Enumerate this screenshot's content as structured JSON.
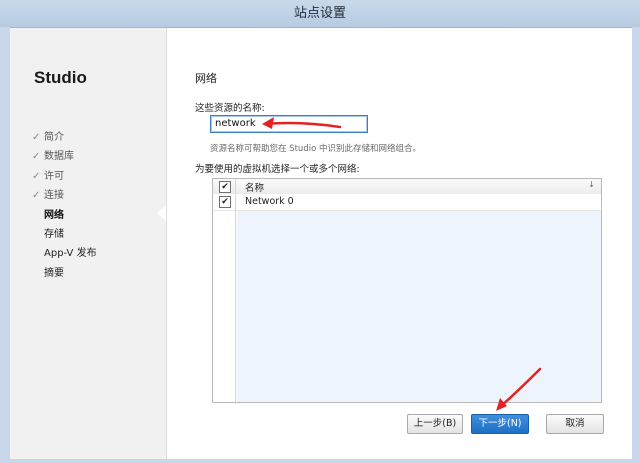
{
  "window": {
    "title": "站点设置"
  },
  "sidebar": {
    "brand": "Studio",
    "steps": [
      {
        "label": "简介",
        "state": "done"
      },
      {
        "label": "数据库",
        "state": "done"
      },
      {
        "label": "许可",
        "state": "done"
      },
      {
        "label": "连接",
        "state": "done"
      },
      {
        "label": "网络",
        "state": "current"
      },
      {
        "label": "存储",
        "state": "pending"
      },
      {
        "label": "App-V 发布",
        "state": "pending"
      },
      {
        "label": "摘要",
        "state": "pending"
      }
    ],
    "done_mark": "✓"
  },
  "main": {
    "section_title": "网络",
    "name_label": "这些资源的名称:",
    "name_value": "network",
    "hint": "资源名称可帮助您在 Studio 中识别此存储和网络组合。",
    "select_label": "为要使用的虚拟机选择一个或多个网络:",
    "grid": {
      "column_name": "名称",
      "sort_icon": "sort-down-icon",
      "rows": [
        {
          "name": "Network 0",
          "checked": true
        }
      ]
    }
  },
  "buttons": {
    "back": "上一步(B)",
    "next": "下一步(N)",
    "cancel": "取消"
  },
  "annotations": {
    "arrow_color": "#e32222"
  }
}
